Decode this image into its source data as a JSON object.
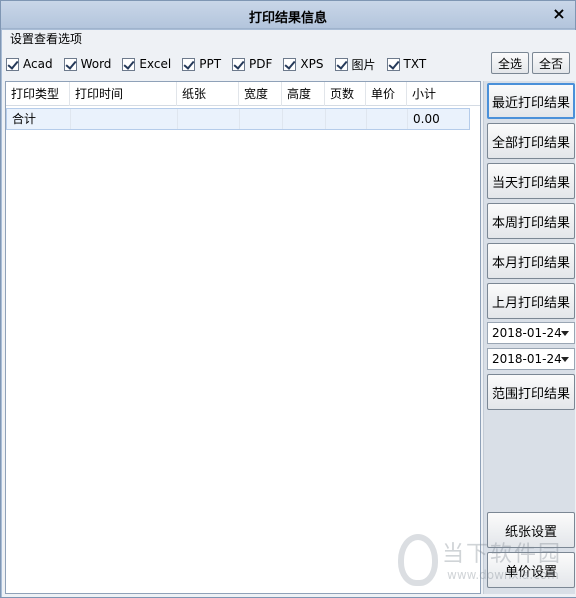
{
  "window": {
    "title": "打印结果信息",
    "close_glyph": "×"
  },
  "options": {
    "group_label": "设置查看选项",
    "filters": [
      {
        "label": "Acad",
        "checked": true
      },
      {
        "label": "Word",
        "checked": true
      },
      {
        "label": "Excel",
        "checked": true
      },
      {
        "label": "PPT",
        "checked": true
      },
      {
        "label": "PDF",
        "checked": true
      },
      {
        "label": "XPS",
        "checked": true
      },
      {
        "label": "图片",
        "checked": true
      },
      {
        "label": "TXT",
        "checked": true
      }
    ],
    "select_all": "全选",
    "select_none": "全否"
  },
  "table": {
    "columns": [
      "打印类型",
      "打印时间",
      "纸张",
      "宽度",
      "高度",
      "页数",
      "单价",
      "小计"
    ],
    "rows": [
      [
        "合计",
        "",
        "",
        "",
        "",
        "",
        "",
        "0.00"
      ]
    ]
  },
  "sidebar": {
    "recent": "最近打印结果",
    "all": "全部打印结果",
    "today": "当天打印结果",
    "week": "本周打印结果",
    "month": "本月打印结果",
    "last_month": "上月打印结果",
    "date_from": "2018-01-24",
    "date_to": "2018-01-24",
    "range": "范围打印结果",
    "paper_settings": "纸张设置",
    "price_settings": "单价设置"
  },
  "watermark": {
    "text": "当下软件园",
    "url": "www.downxia.com"
  },
  "colors": {
    "accent": "#4a90d9",
    "title_bg": "#b3c5dc",
    "row_highlight": "#eaf2fc"
  }
}
